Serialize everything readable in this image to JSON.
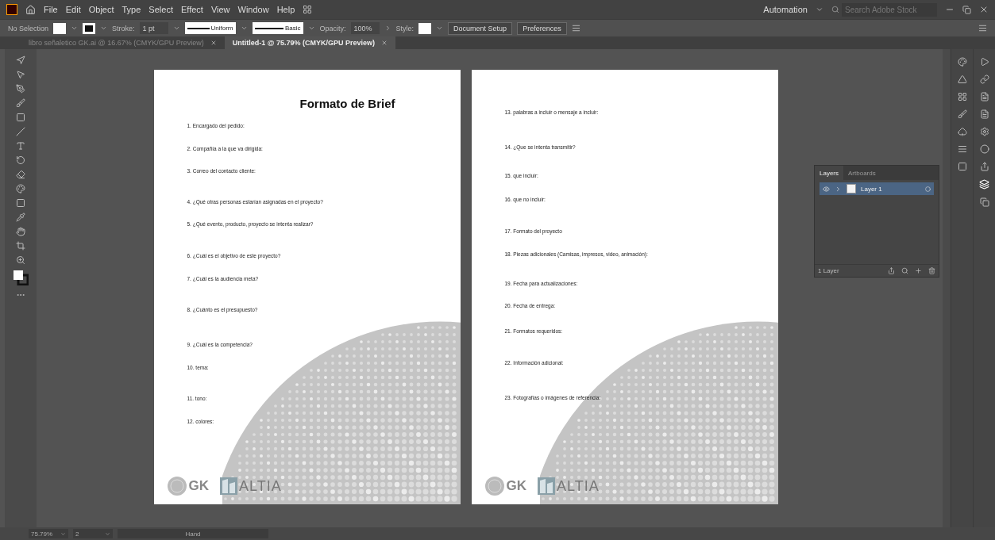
{
  "app": {
    "menu": [
      "File",
      "Edit",
      "Object",
      "Type",
      "Select",
      "Effect",
      "View",
      "Window",
      "Help"
    ],
    "workspace": "Automation",
    "search": {
      "placeholder": "Search Adobe Stock"
    }
  },
  "control_bar": {
    "selection": "No Selection",
    "stroke_label": "Stroke:",
    "stroke_value": "1 pt",
    "profile": "Uniform",
    "brush": "Basic",
    "opacity_label": "Opacity:",
    "opacity_value": "100%",
    "style_label": "Style:",
    "buttons": [
      "Document Setup",
      "Preferences"
    ]
  },
  "tabs": [
    {
      "label": "libro señaletico GK.ai @ 16.67% (CMYK/GPU Preview)",
      "selected": false
    },
    {
      "label": "Untitled-1 @ 75.79% (CMYK/GPU Preview)",
      "selected": true
    }
  ],
  "artboards": [
    {
      "title": "Formato de Brief",
      "items": [
        "1.  Encargado del pedido:",
        "2.  Compañía a la que va dirigida:",
        "3.  Correo del contacto cliente:",
        "4.  ¿Qué otras personas estarían asignadas en el proyecto?",
        "5.  ¿Qué evento, producto, proyecto se intenta realizar?",
        "6.  ¿Cuál es el objetivo de este proyecto?",
        "7.  ¿Cuál es la audiencia meta?",
        "8.  ¿Cuánto es el presupuesto?",
        "9.  ¿Cuál es la competencia?",
        "10. tema:",
        "11. tono:",
        "12. colores:"
      ],
      "logos": {
        "gk": "GK",
        "altia": "ALTIA"
      }
    },
    {
      "items": [
        "13. palabras a incluir o mensaje a incluir:",
        "14. ¿Que se intenta transmitir?",
        "15. que incluir:",
        "16. que no incluir:",
        "17. Formato del proyecto",
        "18. Piezas adicionales (Camisas, impresos, video, animación):",
        "19. Fecha para actualizaciones:",
        "20. Fecha de entrega:",
        "21. Formatos requeridos:",
        "22. Información adicional:",
        "23.  Fotografías o imágenes de referencia:"
      ],
      "logos": {
        "gk": "GK",
        "altia": "ALTIA"
      }
    }
  ],
  "layers_panel": {
    "tabs": [
      {
        "label": "Layers",
        "selected": true
      },
      {
        "label": "Artboards",
        "selected": false
      }
    ],
    "layers": [
      {
        "name": "Layer 1",
        "selected": true
      }
    ],
    "footer": "1 Layer"
  },
  "status_bar": {
    "zoom": "75.79%",
    "artboard": "2",
    "tool": "Hand"
  }
}
